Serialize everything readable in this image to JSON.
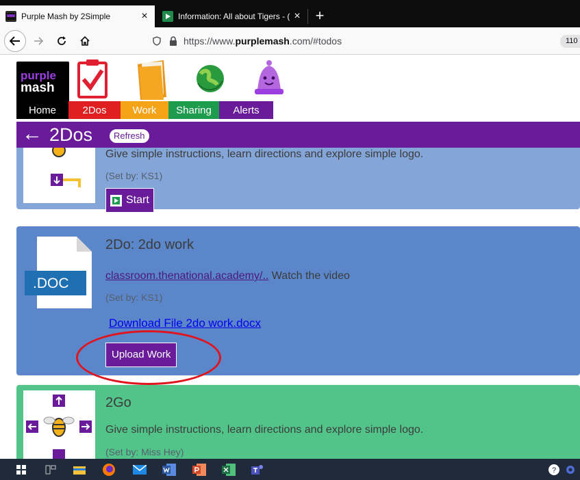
{
  "browser": {
    "tabs": [
      {
        "title": "Purple Mash by 2Simple",
        "close": "×"
      },
      {
        "title": "Information: All about Tigers - ( ",
        "close": "×"
      }
    ],
    "new_tab": "+",
    "url_prefix": "https://www.",
    "url_domain": "purplemash",
    "url_suffix": ".com/#todos",
    "zoom": "110"
  },
  "app": {
    "logo_top": "purple",
    "logo_bottom": "mash",
    "menu": [
      {
        "label": "Home",
        "color": "#000000"
      },
      {
        "label": "2Dos",
        "color": "#e02020"
      },
      {
        "label": "Work",
        "color": "#f5a418"
      },
      {
        "label": "Sharing",
        "color": "#1d9c4d"
      },
      {
        "label": "Alerts",
        "color": "#6a1b9a"
      }
    ],
    "page_title": "2Dos",
    "refresh_label": "Refresh"
  },
  "cards": [
    {
      "desc": "Give simple instructions, learn directions and explore simple logo.",
      "set_by": "(Set by: KS1)",
      "start_label": "Start"
    },
    {
      "thumb_label": ".DOC",
      "title": "2Do: 2do work",
      "link": "classroom.thenational.academy/..",
      "desc_after": " Watch the video",
      "set_by": "(Set by: KS1)",
      "download_label": "Download File 2do work.docx",
      "upload_label": "Upload Work"
    },
    {
      "title": "2Go",
      "desc": "Give simple instructions, learn directions and explore simple logo.",
      "set_by": "(Set by: Miss Hey)"
    }
  ],
  "colors": {
    "purple": "#6a1b9a",
    "card_light_blue": "#84a5d8",
    "card_blue": "#5b86c9",
    "card_green": "#52c48a",
    "annotation_red": "#e0141c"
  }
}
